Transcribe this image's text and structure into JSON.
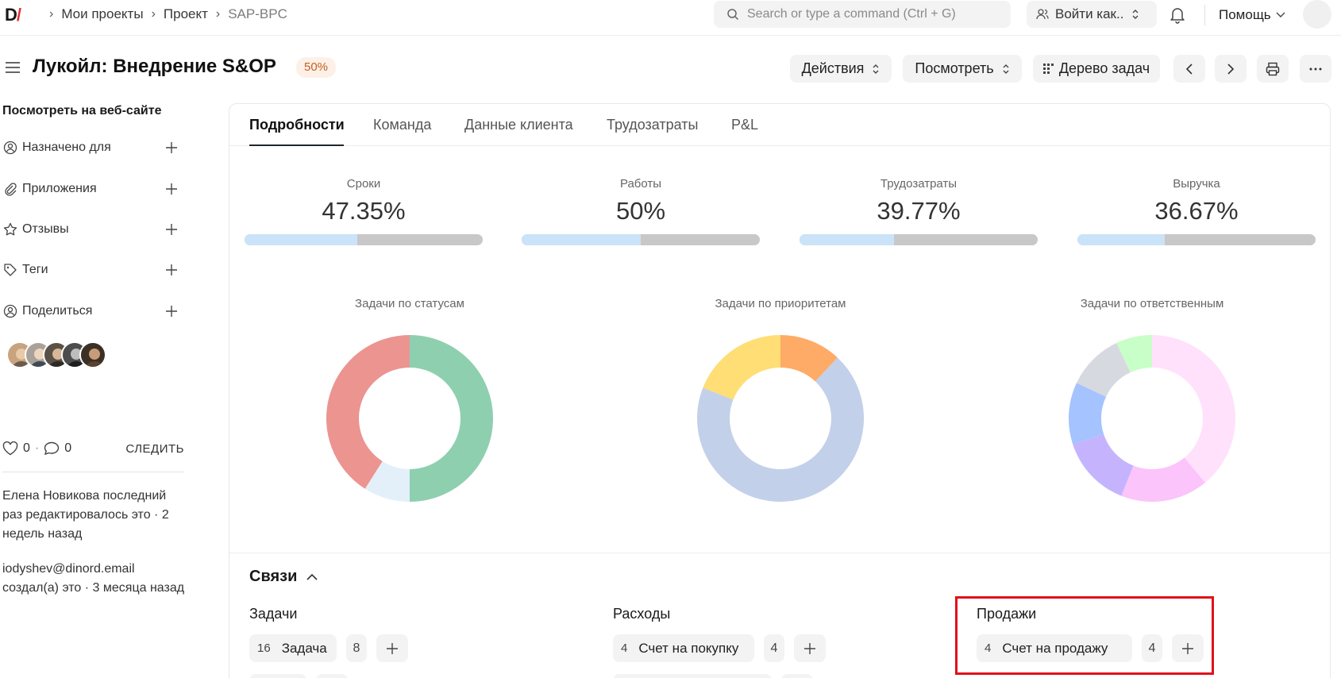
{
  "navbar": {
    "logo_text": "D",
    "logo_slash": "/",
    "breadcrumbs": [
      "Мои проекты",
      "Проект",
      "SAP-BPC"
    ],
    "search_placeholder": "Search or type a command (Ctrl + G)",
    "login_as_label": "Войти как..",
    "help_label": "Помощь"
  },
  "header": {
    "title": "Лукойл: Внедрение S&OP",
    "progress_badge": "50%",
    "actions_label": "Действия",
    "view_label": "Посмотреть",
    "tree_label": "Дерево задач"
  },
  "sidebar": {
    "web_link": "Посмотреть на веб-сайте",
    "items": [
      {
        "label": "Назначено для",
        "icon": "user-assign-icon"
      },
      {
        "label": "Приложения",
        "icon": "paperclip-icon"
      },
      {
        "label": "Отзывы",
        "icon": "star-icon"
      },
      {
        "label": "Теги",
        "icon": "tag-icon"
      },
      {
        "label": "Поделиться",
        "icon": "share-user-icon"
      }
    ],
    "likes_count": "0",
    "comments_count": "0",
    "follow_label": "СЛЕДИТЬ",
    "activity": [
      "Елена Новикова последний раз редактировалось это · 2 недель назад",
      "iodyshev@dinord.email создал(а) это · 3 месяца назад"
    ]
  },
  "tabs": [
    "Подробности",
    "Команда",
    "Данные клиента",
    "Трудозатраты",
    "P&L"
  ],
  "metrics": [
    {
      "label": "Сроки",
      "value": "47.35%",
      "fraction": 0.4735
    },
    {
      "label": "Работы",
      "value": "50%",
      "fraction": 0.5
    },
    {
      "label": "Трудозатраты",
      "value": "39.77%",
      "fraction": 0.3977
    },
    {
      "label": "Выручка",
      "value": "36.67%",
      "fraction": 0.3667
    }
  ],
  "chart_data": [
    {
      "type": "pie",
      "title": "Задачи по статусам",
      "values": [
        50,
        9,
        41
      ],
      "colors": [
        "#8ecfb0",
        "#e3f0fa",
        "#ec9490"
      ]
    },
    {
      "type": "pie",
      "title": "Задачи по приоритетам",
      "values": [
        12,
        69,
        19
      ],
      "colors": [
        "#fdab66",
        "#c3d0e9",
        "#fede75"
      ]
    },
    {
      "type": "pie",
      "title": "Задачи по ответственным",
      "values": [
        39,
        17,
        14,
        12,
        11,
        7
      ],
      "colors": [
        "#ffe1fb",
        "#fbc4fa",
        "#c5b4fd",
        "#a5c3fe",
        "#d6dae0",
        "#c8fec7"
      ]
    }
  ],
  "links": {
    "title": "Связи",
    "groups": [
      {
        "title": "Задачи",
        "count": "16",
        "label": "Задача",
        "secondary": "8"
      },
      {
        "title": "Расходы",
        "count": "4",
        "label": "Счет на покупку",
        "secondary": "4"
      },
      {
        "title": "Продажи",
        "count": "4",
        "label": "Счет на продажу",
        "secondary": "4"
      }
    ]
  }
}
